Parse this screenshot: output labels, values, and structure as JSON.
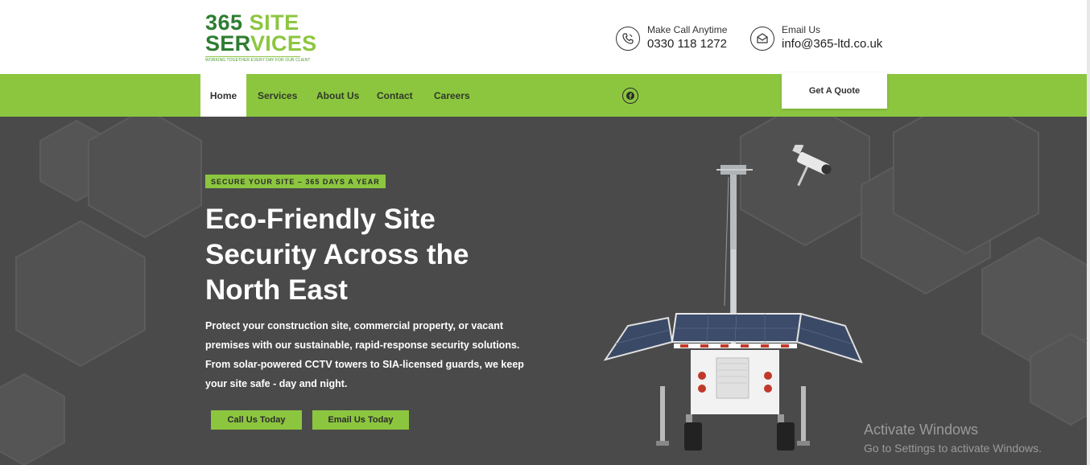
{
  "header": {
    "logo": {
      "line1_a": "365",
      "line1_b": "SITE",
      "line2_a": "SER",
      "line2_b": "VICES",
      "tagline": "WORKING TOGETHER EVERY DAY FOR OUR CLIENT"
    },
    "phone": {
      "label": "Make Call Anytime",
      "value": "0330 118 1272",
      "icon": "phone-icon"
    },
    "email": {
      "label": "Email Us",
      "value": "info@365-ltd.co.uk",
      "icon": "envelope-icon"
    }
  },
  "nav": {
    "items": [
      {
        "label": "Home",
        "active": true
      },
      {
        "label": "Services"
      },
      {
        "label": "About Us"
      },
      {
        "label": "Contact"
      },
      {
        "label": "Careers"
      }
    ],
    "social_icon": "facebook-icon",
    "quote_label": "Get A Quote"
  },
  "hero": {
    "badge": "SECURE YOUR SITE – 365 DAYS A YEAR",
    "headline_lines": [
      "Eco-Friendly Site",
      "Security Across the",
      "North East"
    ],
    "description_lines": [
      "Protect your construction site, commercial property, or vacant",
      "premises with our sustainable, rapid-response security solutions.",
      "From solar-powered CCTV towers to SIA-licensed guards, we keep",
      "your site safe - day and night."
    ],
    "buttons": [
      {
        "label": "Call Us Today"
      },
      {
        "label": "Email Us Today"
      }
    ]
  },
  "watermark": {
    "title": "Activate Windows",
    "subtitle": "Go to Settings to activate Windows."
  },
  "colors": {
    "brand_green": "#8cc63f",
    "dark_green": "#2e7d32",
    "hero_bg": "#4a4a4a"
  }
}
